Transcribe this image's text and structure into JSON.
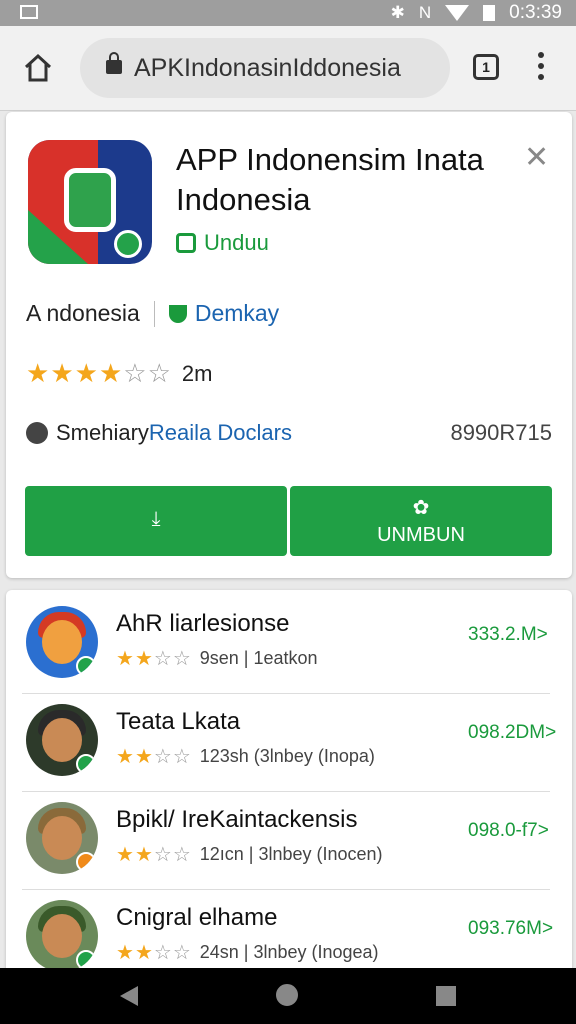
{
  "statusbar": {
    "time": "0:3:39"
  },
  "browser": {
    "url": "APKIndonasinIddonesia",
    "tabs_count": "1"
  },
  "app_card": {
    "title": "APP Indonensim Inata Indonesia",
    "download_label": "Unduu",
    "country": "A ndonesia",
    "developer": "Demkay",
    "rating_stars": 3.5,
    "rating_count": "2m",
    "size_prefix": "Smehiary",
    "size_link": "Reaila Doclars",
    "size_value": "8990R715",
    "primary_button_label": "",
    "secondary_button_label": "UNMBUN"
  },
  "list": {
    "items": [
      {
        "name": "AhR liarlesionse",
        "stars": 2.5,
        "meta": "9sen | 1eatkon",
        "size": "333.2.M>"
      },
      {
        "name": "Teata Lkata",
        "stars": 2.5,
        "meta": "123sh (3lnbey (Inopa)",
        "size": "098.2DM>"
      },
      {
        "name": "Bpikl/ IreKaintackensis",
        "stars": 2.5,
        "meta": "12ıcn | 3lnbey (Inocen)",
        "size": "098.0-f7>"
      },
      {
        "name": "Cnigral elhame",
        "stars": 2.5,
        "meta": "24sn | 3lnbey (Inogea)",
        "size": "093.76M>"
      }
    ]
  }
}
